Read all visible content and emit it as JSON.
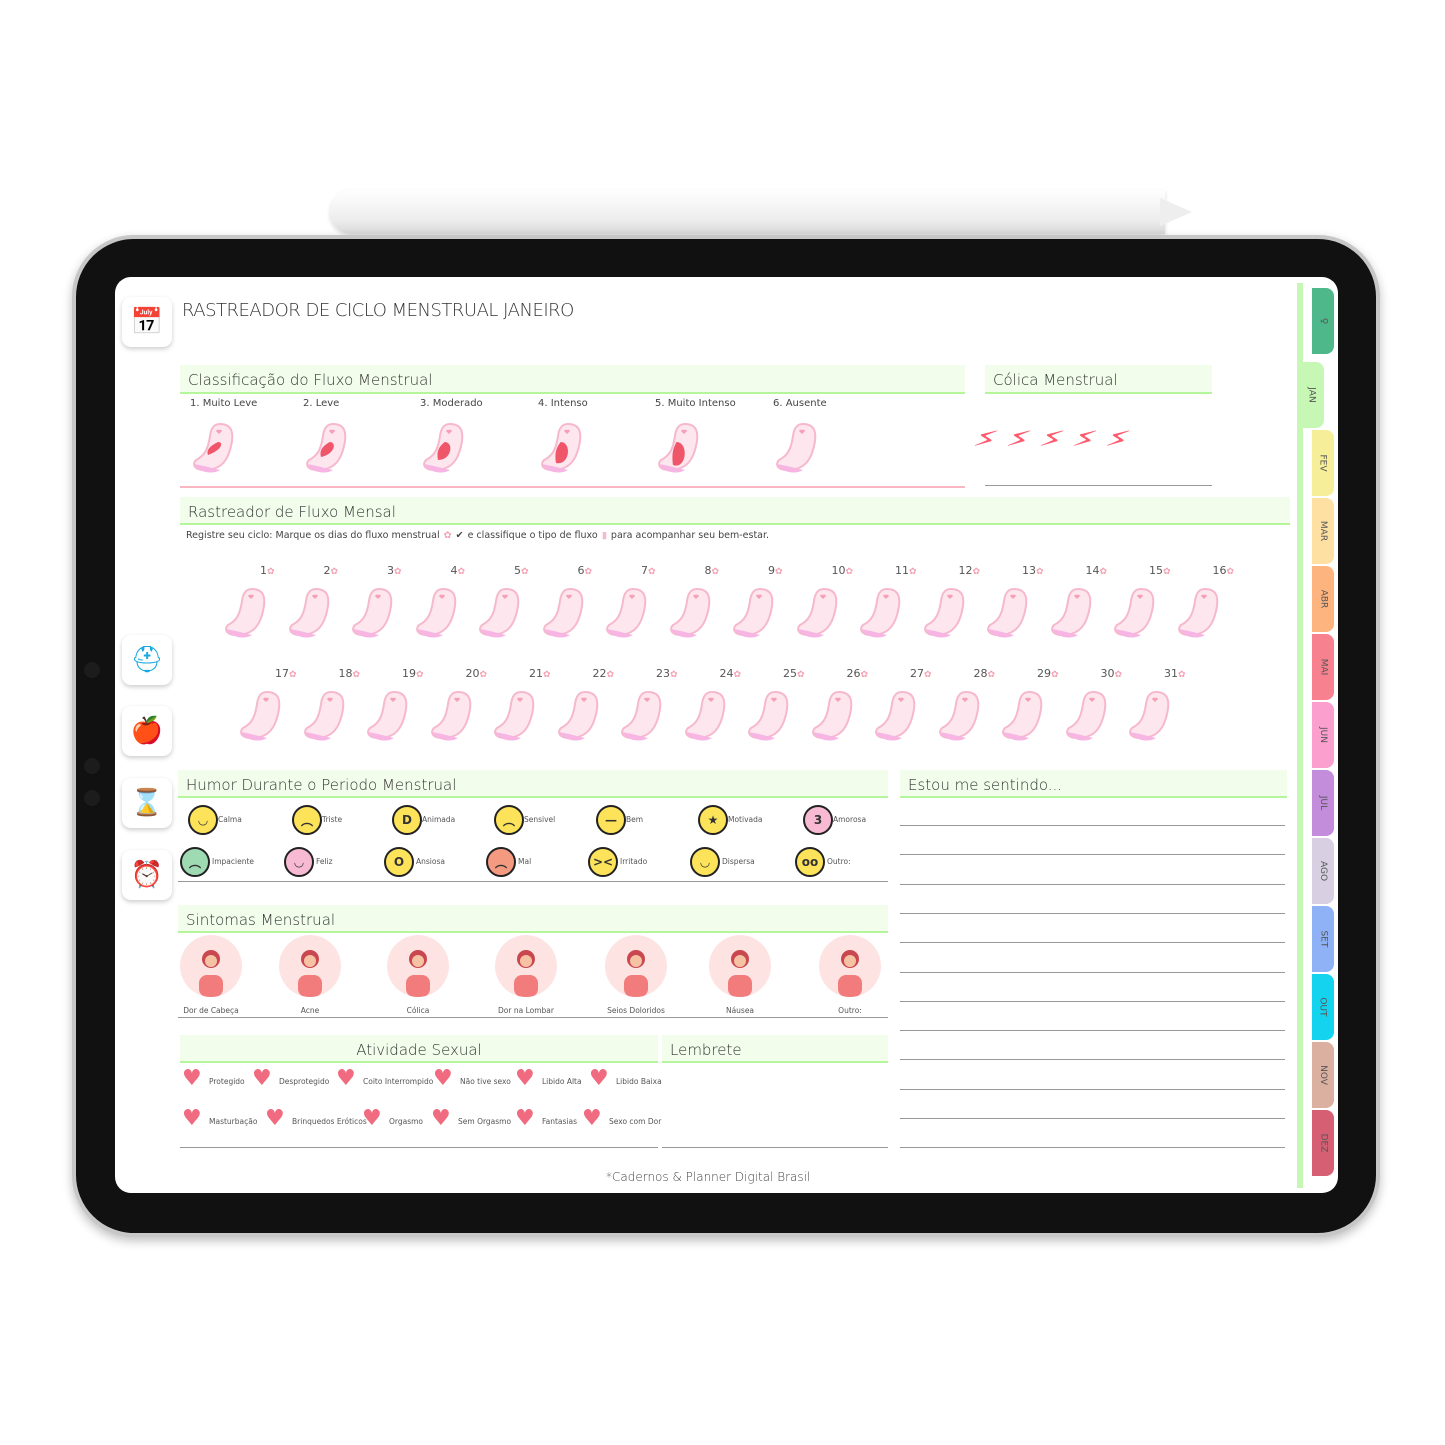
{
  "title": "RASTREADOR DE CICLO MENSTRUAL JANEIRO",
  "colors": {
    "header_bg": "#f2fdeb",
    "header_border": "#b5f59c",
    "pad_pink": "#f6b8cc",
    "flow_red": "#f0566a",
    "heart": "#f06a80",
    "bolt": "#ff5a6e"
  },
  "flow_classification": {
    "title": "Classificação do Fluxo Menstrual",
    "items": [
      {
        "label": "1. Muito Leve",
        "level": 1
      },
      {
        "label": "2. Leve",
        "level": 2
      },
      {
        "label": "3. Moderado",
        "level": 3
      },
      {
        "label": "4. Intenso",
        "level": 4
      },
      {
        "label": "5. Muito Intenso",
        "level": 5
      },
      {
        "label": "6. Ausente",
        "level": 0
      }
    ]
  },
  "cramps": {
    "title": "Cólica Menstrual",
    "bolts": 5,
    "bolt_icon": "lightning-icon"
  },
  "tracker": {
    "title": "Rastreador de Fluxo Mensal",
    "instruction_1": "Registre seu ciclo: Marque os dias do fluxo menstrual",
    "instruction_2": "e classifique o tipo de fluxo",
    "instruction_3": "para acompanhar seu bem-estar.",
    "days_row1": [
      "1",
      "2",
      "3",
      "4",
      "5",
      "6",
      "7",
      "8",
      "9",
      "10",
      "11",
      "12",
      "13",
      "14",
      "15",
      "16"
    ],
    "days_row2": [
      "17",
      "18",
      "19",
      "20",
      "21",
      "22",
      "23",
      "24",
      "25",
      "26",
      "27",
      "28",
      "29",
      "30",
      "31"
    ]
  },
  "mood": {
    "title": "Humor Durante o Periodo Menstrual",
    "items": [
      {
        "label": "Calma",
        "color": "#fde35a",
        "face": "◡"
      },
      {
        "label": "Triste",
        "color": "#fde35a",
        "face": "︵"
      },
      {
        "label": "Animada",
        "color": "#fde35a",
        "face": "D"
      },
      {
        "label": "Sensivel",
        "color": "#fde35a",
        "face": "︵"
      },
      {
        "label": "Bem",
        "color": "#fde35a",
        "face": "—"
      },
      {
        "label": "Motivada",
        "color": "#fde35a",
        "face": "★"
      },
      {
        "label": "Amorosa",
        "color": "#f8b9d3",
        "face": "3"
      },
      {
        "label": "Impaciente",
        "color": "#9edbb3",
        "face": "︵"
      },
      {
        "label": "Feliz",
        "color": "#f8b9d3",
        "face": "◡"
      },
      {
        "label": "Ansiosa",
        "color": "#fde35a",
        "face": "O"
      },
      {
        "label": "Mal",
        "color": "#f49a80",
        "face": "︵"
      },
      {
        "label": "Irritado",
        "color": "#fde35a",
        "face": "><"
      },
      {
        "label": "Dispersa",
        "color": "#fde35a",
        "face": "◡"
      },
      {
        "label": "Outro:",
        "color": "#fde35a",
        "face": "oo"
      }
    ]
  },
  "feeling": {
    "title": "Estou me sentindo..."
  },
  "symptoms": {
    "title": "Sintomas Menstrual",
    "items": [
      "Dor de Cabeça",
      "Acne",
      "Cólica",
      "Dor na Lombar",
      "Seios Doloridos",
      "Náusea",
      "Outro:"
    ]
  },
  "sexual": {
    "title": "Atividade Sexual",
    "row1": [
      "Protegido",
      "Desprotegido",
      "Coito Interrompido",
      "Não tive sexo",
      "Libido Alta",
      "Libido Baixa"
    ],
    "row2": [
      "Masturbação",
      "Brinquedos Eróticos",
      "Orgasmo",
      "Sem Orgasmo",
      "Fantasias",
      "Sexo com Dor"
    ]
  },
  "reminder": {
    "title": "Lembrete"
  },
  "footer": "*Cadernos & Planner Digital Brasil",
  "tabs": [
    {
      "label": "",
      "color": "#4fb88a"
    },
    {
      "label": "JAN",
      "color": "#c6f7b4"
    },
    {
      "label": "FEV",
      "color": "#f6ee98"
    },
    {
      "label": "MAR",
      "color": "#fde0a2"
    },
    {
      "label": "ABR",
      "color": "#fdb47e"
    },
    {
      "label": "MAI",
      "color": "#f8818f"
    },
    {
      "label": "JUN",
      "color": "#fb9fcf"
    },
    {
      "label": "JUL",
      "color": "#c38ddc"
    },
    {
      "label": "AGO",
      "color": "#d8d0e2"
    },
    {
      "label": "SET",
      "color": "#8fb1f6"
    },
    {
      "label": "OUT",
      "color": "#13d3ee"
    },
    {
      "label": "NOV",
      "color": "#dcb0a0"
    },
    {
      "label": "DEZ",
      "color": "#d65f73"
    }
  ],
  "sidebar": [
    {
      "icon": "calendar-planner-icon"
    },
    {
      "icon": "first-aid-kit-icon"
    },
    {
      "icon": "apple-measuring-tape-icon"
    },
    {
      "icon": "calendar-hourglass-icon"
    },
    {
      "icon": "calendar-alarm-icon"
    }
  ]
}
